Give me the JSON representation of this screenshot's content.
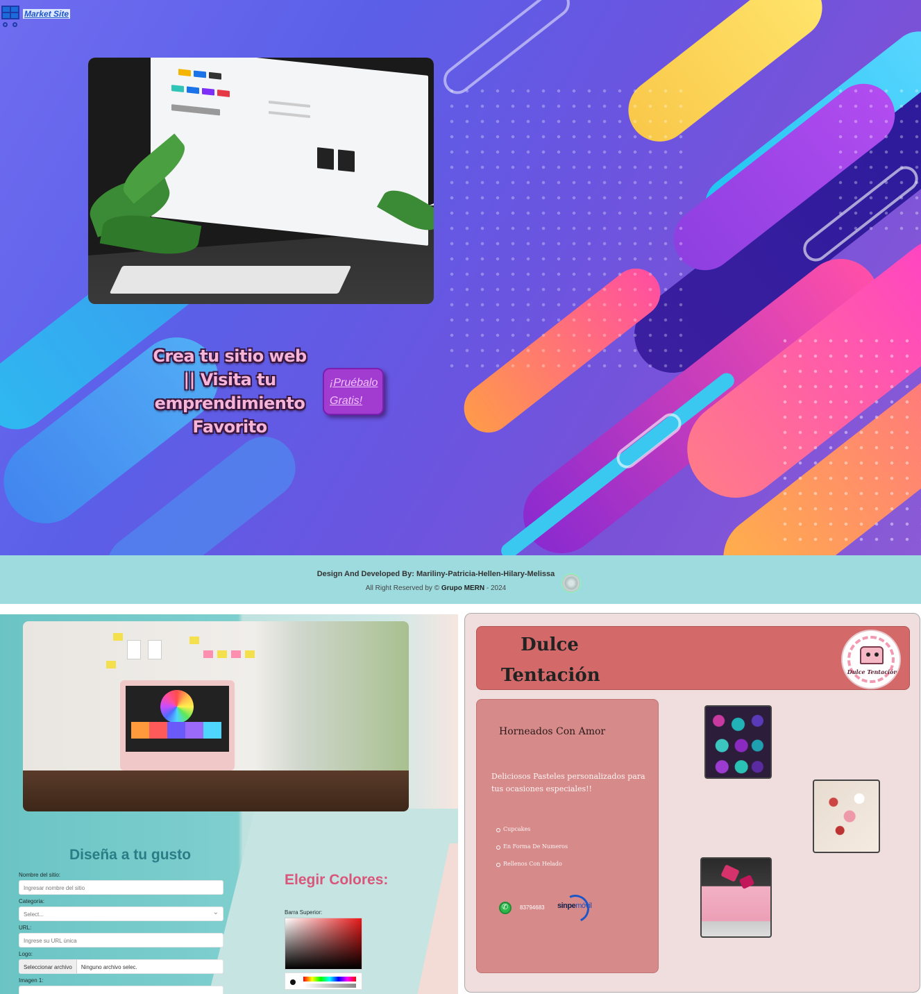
{
  "app": {
    "logo_text": "Market Site"
  },
  "hero": {
    "title": "Crea tu sitio web || Visita tu emprendimiento Favorito",
    "cta_label": "¡Pruébalo Gratis!"
  },
  "footer": {
    "credits": "Design And Developed By: Mariliny-Patricia-Hellen-Hilary-Melissa",
    "rights_prefix": "All Right Reserved by © ",
    "rights_group": "Grupo MERN",
    "rights_year": " - 2024"
  },
  "builder": {
    "title": "Diseña a tu gusto",
    "fields": [
      {
        "label": "Nombre del sitio:",
        "placeholder": "Ingresar nombre del sitio"
      },
      {
        "label": "Categoria:",
        "placeholder": "Select..."
      },
      {
        "label": "URL:",
        "placeholder": "Ingrese su URL única"
      },
      {
        "label": "Logo:",
        "button": "Seleccionar archivo",
        "file": "Ninguno archivo selec."
      },
      {
        "label": "Imagen 1:"
      }
    ],
    "colors_title": "Elegir Colores:",
    "picker_label": "Barra Superior:"
  },
  "shop": {
    "name": "Dulce Tentación",
    "name_line1": "Dulce",
    "name_line2": "Tentación",
    "logo_text": "Dulce Tentación",
    "subtitle": "Horneados Con Amor",
    "description": "Deliciosos Pasteles personalizados para tus ocasiones especiales!!",
    "items": [
      "Cupcakes",
      "En Forma De Numeros",
      "Rellenos Con Helado"
    ],
    "phone": "83794683",
    "payment": "sinpe",
    "payment_suffix": "móvil"
  },
  "colors": {
    "hero_bg": "#6a5ee6",
    "footer_bg": "#9ddbde",
    "cta": "#a23bd0",
    "shop_header": "#d36a69",
    "shop_card": "#d68a8a",
    "builder_title": "#2a7d86",
    "colors_title": "#d9567a"
  }
}
